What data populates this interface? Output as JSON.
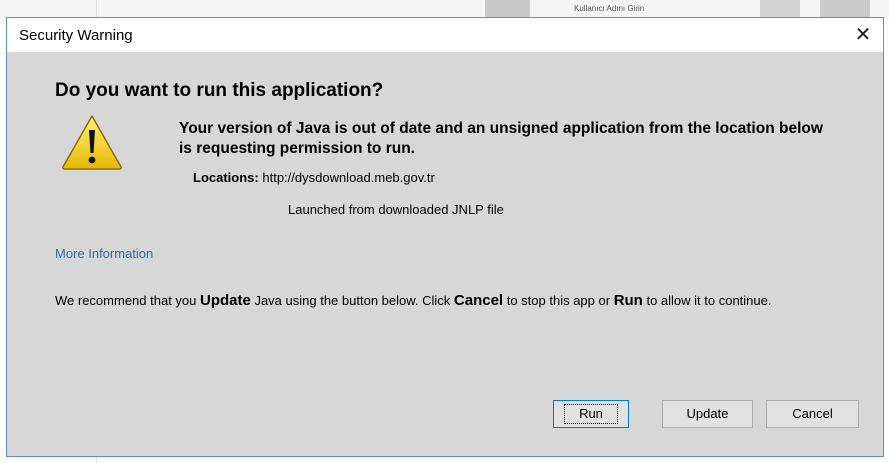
{
  "background": {
    "text": "Kullanıcı Adını Girin"
  },
  "dialog": {
    "title": "Security Warning",
    "close_glyph": "✕",
    "heading": "Do you want to run this application?",
    "icon": "warning-icon",
    "message": "Your version of Java is out of date and an unsigned application from the location below is requesting permission to run.",
    "locations_label": "Locations:",
    "locations_value": "http://dysdownload.meb.gov.tr",
    "launched_from": "Launched from downloaded JNLP file",
    "more_info_link": "More Information",
    "recommend": {
      "part1": "We recommend that you ",
      "update_word": "Update",
      "part2": " Java using the button below. Click ",
      "cancel_word": "Cancel",
      "part3": " to stop this app or ",
      "run_word": "Run",
      "part4": " to allow it to continue."
    },
    "buttons": {
      "run": "Run",
      "update": "Update",
      "cancel": "Cancel"
    }
  },
  "colors": {
    "dialog_bg": "#d7d7d7",
    "link": "#35689e",
    "warning_yellow": "#f5d60a",
    "focus_border": "#0078d7"
  }
}
